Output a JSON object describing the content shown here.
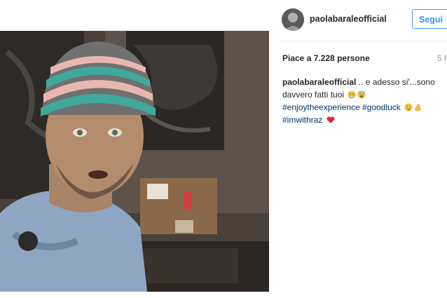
{
  "post": {
    "username": "paolabaraleofficial",
    "follow_label": "Segui",
    "likes_text": "Piace a 7.228 persone",
    "time_text": "5 h",
    "caption": {
      "username": "paolabaraleofficial",
      "line1": ".. e adesso si'...sono davvero fatti tuoi",
      "hashtag1": "#enjoytheexperience",
      "hashtag2": "#goodluck",
      "hashtag3": "#imwithraz"
    }
  },
  "colors": {
    "accent": "#3897f0",
    "hashtag": "#003569",
    "heart": "#ed4956"
  }
}
